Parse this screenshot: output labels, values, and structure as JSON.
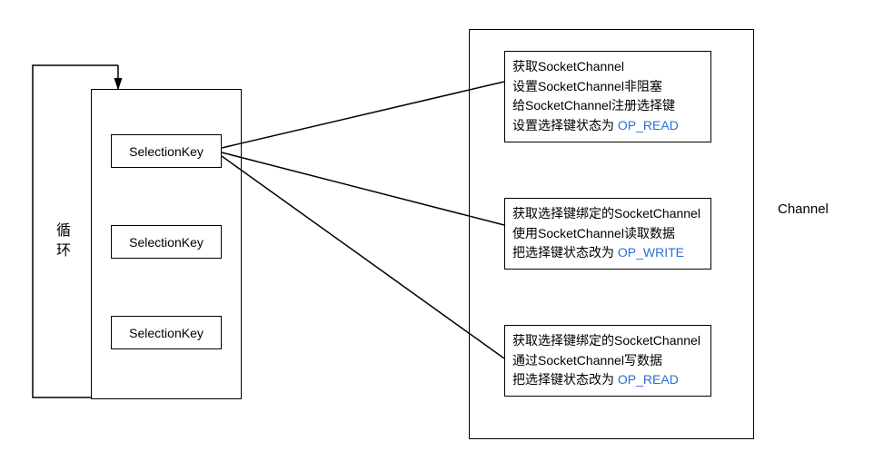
{
  "loop": {
    "label": "循环",
    "keys": [
      {
        "label": "SelectionKey"
      },
      {
        "label": "SelectionKey"
      },
      {
        "label": "SelectionKey"
      }
    ]
  },
  "channel": {
    "label": "Channel",
    "boxes": [
      {
        "line1": "获取SocketChannel",
        "line2": "设置SocketChannel非阻塞",
        "line3": "给SocketChannel注册选择键",
        "line4_prefix": "设置选择键状态为 ",
        "line4_op": "OP_READ"
      },
      {
        "line1": "获取选择键绑定的SocketChannel",
        "line2": "使用SocketChannel读取数据",
        "line3_prefix": "把选择键状态改为 ",
        "line3_op": "OP_WRITE"
      },
      {
        "line1": "获取选择键绑定的SocketChannel",
        "line2": "通过SocketChannel写数据",
        "line3_prefix": "把选择键状态改为 ",
        "line3_op": "OP_READ"
      }
    ]
  }
}
